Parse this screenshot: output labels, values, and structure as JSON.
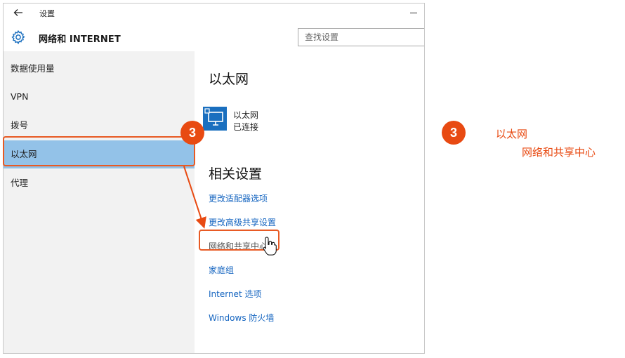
{
  "window": {
    "title": "设置",
    "back_icon": "arrow-left-icon",
    "minimize_icon": "minimize-icon"
  },
  "header": {
    "icon": "gear-icon",
    "section_title": "网络和 INTERNET",
    "search_placeholder": "查找设置"
  },
  "sidebar": {
    "items": [
      {
        "label": "数据使用量"
      },
      {
        "label": "VPN"
      },
      {
        "label": "拨号"
      },
      {
        "label": "以太网",
        "selected": true
      },
      {
        "label": "代理"
      }
    ]
  },
  "content": {
    "heading": "以太网",
    "ethernet": {
      "icon": "ethernet-monitor-icon",
      "name": "以太网",
      "status": "已连接"
    },
    "related_heading": "相关设置",
    "links": [
      {
        "label": "更改适配器选项"
      },
      {
        "label": "更改高级共享设置"
      },
      {
        "label": "网络和共享中心",
        "highlighted": true
      },
      {
        "label": "家庭组"
      },
      {
        "label": "Internet 选项"
      },
      {
        "label": "Windows 防火墙"
      }
    ]
  },
  "annotation": {
    "step_number": "3",
    "line1": "以太网",
    "line2": "网络和共享中心",
    "accent_color": "#e84a12",
    "selection_color": "#93c2e8",
    "link_color": "#1565c0"
  }
}
